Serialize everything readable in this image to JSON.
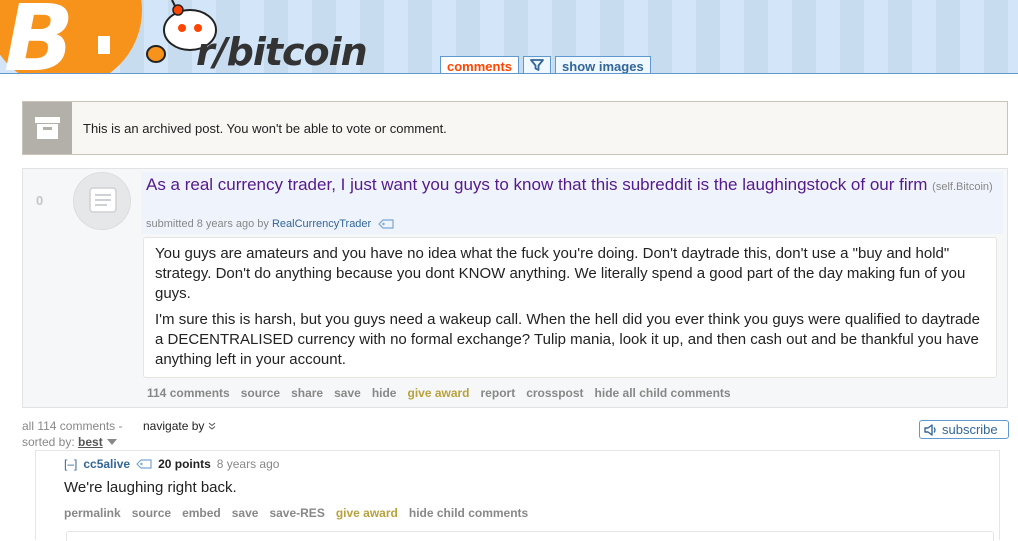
{
  "header": {
    "logo": "bitcoin-b-logo",
    "subreddit_title": "r/bitcoin",
    "tabs": [
      {
        "label": "comments",
        "selected": true
      },
      {
        "label": "filter",
        "icon": "funnel-icon"
      },
      {
        "label": "show images",
        "selected": false
      }
    ]
  },
  "archived": {
    "icon": "archive-box-icon",
    "message": "This is an archived post. You won't be able to vote or comment."
  },
  "post": {
    "score": "0",
    "thumbnail_icon": "self-post-icon",
    "title": "As a real currency trader, I just want you guys to know that this subreddit is the laughingstock of our firm",
    "domain": "(self.Bitcoin)",
    "submitted_prefix": "submitted 8 years ago by",
    "author": "RealCurrencyTrader",
    "body": [
      "You guys are amateurs and you have no idea what the fuck you're doing. Don't daytrade this, don't use a \"buy and hold\" strategy. Don't do anything because you dont KNOW anything. We literally spend a good part of the day making fun of you guys.",
      "I'm sure this is harsh, but you guys need a wakeup call. When the hell did you ever think you guys were qualified to daytrade a DECENTRALISED currency with no formal exchange? Tulip mania, look it up, and then cash out and be thankful you have anything left in your account."
    ],
    "buttons": [
      "114 comments",
      "source",
      "share",
      "save",
      "hide",
      "give award",
      "report",
      "crosspost",
      "hide all child comments"
    ]
  },
  "comments_area": {
    "count_label": "all 114 comments",
    "separator": "-",
    "navigate_label": "navigate by",
    "sorted_label": "sorted by:",
    "sort_value": "best",
    "subscribe_label": "subscribe"
  },
  "comment": {
    "collapse": "[–]",
    "author": "cc5alive",
    "points": "20 points",
    "time": "8 years ago",
    "body": "We're laughing right back.",
    "buttons": [
      "permalink",
      "source",
      "embed",
      "save",
      "save-RES",
      "give award",
      "hide child comments"
    ]
  },
  "colors": {
    "header_bg": "#cee3f8",
    "logo_orange": "#f7931a",
    "title_purple": "#551a8b",
    "link_blue": "#369",
    "tab_selected": "#ff4500",
    "award_gold": "#b8a23e"
  }
}
